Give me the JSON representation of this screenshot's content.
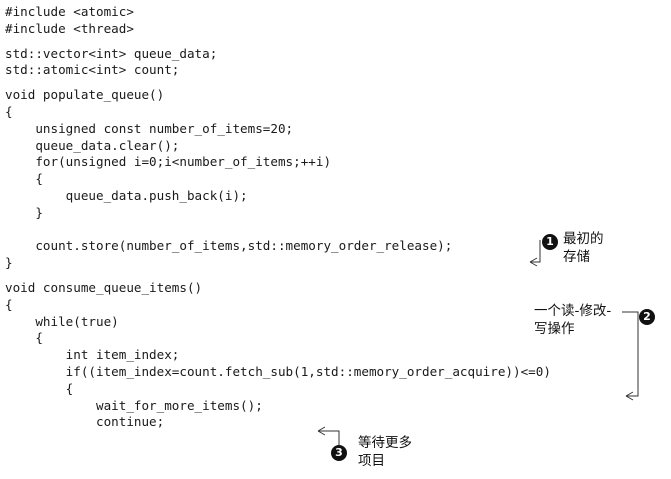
{
  "code": {
    "block1": [
      "#include <atomic>",
      "#include <thread>"
    ],
    "block2": [
      "std::vector<int> queue_data;",
      "std::atomic<int> count;"
    ],
    "block3": [
      "void populate_queue()",
      "{",
      "    unsigned const number_of_items=20;",
      "    queue_data.clear();",
      "    for(unsigned i=0;i<number_of_items;++i)",
      "    {",
      "        queue_data.push_back(i);",
      "    }",
      "",
      "    count.store(number_of_items,std::memory_order_release);",
      "}"
    ],
    "block4": [
      "void consume_queue_items()",
      "{",
      "    while(true)",
      "    {",
      "        int item_index;",
      "        if((item_index=count.fetch_sub(1,std::memory_order_acquire))<=0)",
      "        {",
      "            wait_for_more_items();",
      "            continue;"
    ]
  },
  "callouts": [
    {
      "number": "1",
      "line1": "最初的",
      "line2": "存储"
    },
    {
      "number": "2",
      "line1": "一个读-修改-",
      "line2": "写操作"
    },
    {
      "number": "3",
      "line1": "等待更多",
      "line2": "项目"
    }
  ]
}
